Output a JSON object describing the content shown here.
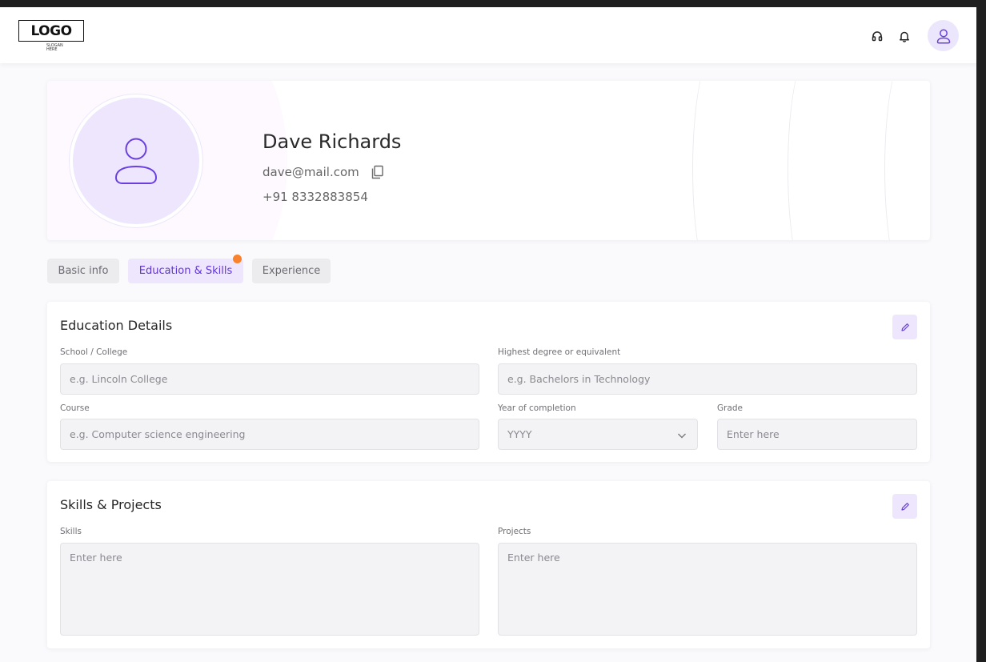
{
  "header": {
    "logo_text": "LOGO",
    "logo_sub_line1": "SLOGAN",
    "logo_sub_line2": "HERE",
    "icons": [
      "headset-icon",
      "bell-icon",
      "user-icon"
    ]
  },
  "profile": {
    "name": "Dave Richards",
    "email": "dave@mail.com",
    "phone": "+91 8332883854"
  },
  "tabs": [
    {
      "label": "Basic info",
      "active": false
    },
    {
      "label": "Education & Skills",
      "active": true
    },
    {
      "label": "Experience",
      "active": false
    }
  ],
  "education": {
    "title": "Education Details",
    "school_label": "School / College",
    "school_placeholder": "e.g. Lincoln College",
    "degree_label": "Highest degree or equivalent",
    "degree_placeholder": "e.g. Bachelors in Technology",
    "course_label": "Course",
    "course_placeholder": "e.g. Computer science engineering",
    "year_label": "Year of completion",
    "year_value": "YYYY",
    "grade_label": "Grade",
    "grade_placeholder": "Enter here"
  },
  "skills": {
    "title": "Skills & Projects",
    "skills_label": "Skills",
    "skills_placeholder": "Enter here",
    "projects_label": "Projects",
    "projects_placeholder": "Enter here"
  },
  "colors": {
    "accent": "#6235d9",
    "accent_light": "#ede6fd",
    "notification_dot": "#f9822f"
  }
}
